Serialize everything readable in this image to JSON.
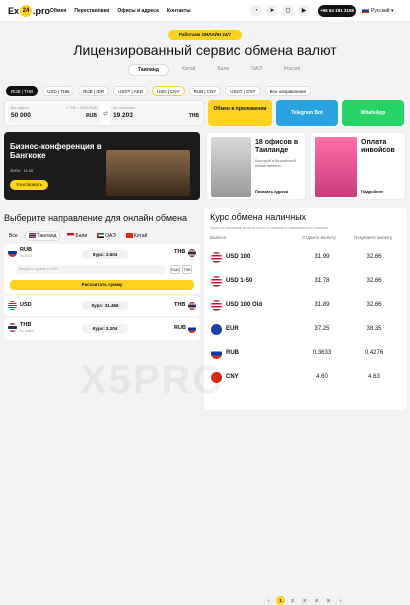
{
  "header": {
    "logo_pre": "Ex",
    "logo_mid": "24",
    "logo_post": ".pro",
    "nav": [
      "Обмен",
      "Перестановки",
      "Офисы и адреса",
      "Контакты"
    ],
    "phone": "+66 64 181 3158",
    "language": "Русский"
  },
  "hero": {
    "badge": "Работаем ОНЛАЙН 24/7",
    "title": "Лицензированный сервис обмена валют",
    "tabs": [
      "Таиланд",
      "Китай",
      "Бали",
      "ОАЭ",
      "Россия"
    ]
  },
  "pairs": [
    "RUB | THB",
    "USD | THB",
    "RUB | IDR",
    "USDT | AED",
    "USD | CNY",
    "RUB | CNY",
    "USDT | CNY",
    "Все направления"
  ],
  "exchange": {
    "give_label": "Вы отдаете",
    "give_value": "50 000",
    "give_cur": "RUB",
    "rate": "1 THB = 2.604 RUB",
    "get_label": "Вы получаете",
    "get_value": "19 203",
    "get_cur": "THB"
  },
  "apps": {
    "app": "Обмен в приложении",
    "telegram": "Telegram Bot",
    "whatsapp": "WhatsApp"
  },
  "promo": {
    "title": "Бизнес-конференция в Бангкоке",
    "date": "30/04 · 11:00",
    "button": "Участвовать"
  },
  "offices": {
    "title": "18 офисов в Таиланде",
    "sub": "Быстрый и безопасный обмен валюты",
    "link": "Показать адреса"
  },
  "invoice": {
    "title": "Оплата инвойсов",
    "link": "Подробнее"
  },
  "direction": {
    "title": "Выберите направление для онлайн обмена",
    "filters": [
      "Все",
      "Таиланд",
      "Бали",
      "ОАЭ",
      "Китай"
    ],
    "rows": [
      {
        "cur": "RUB",
        "info": "по СБП",
        "rate": "Курс: 2.604",
        "to": "THB",
        "input": "Введите сумму в RUB",
        "swap": [
          "RUB",
          "THB"
        ],
        "calc": "Рассчитать сумму"
      },
      {
        "cur": "USD",
        "rate": "Курс: 31.466",
        "to": "THB"
      },
      {
        "cur": "THB",
        "info": "по online",
        "rate": "Курс: 2.204",
        "to": "RUB"
      }
    ]
  },
  "rates": {
    "title": "Курс обмена наличных",
    "sub": "Курсы на наличные валюты могут отличаться в зависимости от локации",
    "headers": [
      "Валюта",
      "Отдаете валюту",
      "Покупаете валюту"
    ],
    "rows": [
      {
        "code": "USD 100",
        "buy": "31.99",
        "sell": "32.66"
      },
      {
        "code": "USD 1-50",
        "buy": "31.78",
        "sell": "32.66"
      },
      {
        "code": "USD 100 Old",
        "buy": "31.89",
        "sell": "32.66"
      },
      {
        "code": "EUR",
        "buy": "37.25",
        "sell": "38.35"
      },
      {
        "code": "RUB",
        "buy": "0.3633",
        "sell": "0.4276"
      },
      {
        "code": "CNY",
        "buy": "4.60",
        "sell": "4.63"
      }
    ],
    "pages": [
      "1",
      "2",
      "3",
      "4",
      "5"
    ]
  },
  "watermark": "X5PRO",
  "colors": {
    "accent": "#ffd21f",
    "dark": "#111111",
    "telegram": "#2aa3e0",
    "whatsapp": "#25d366"
  }
}
